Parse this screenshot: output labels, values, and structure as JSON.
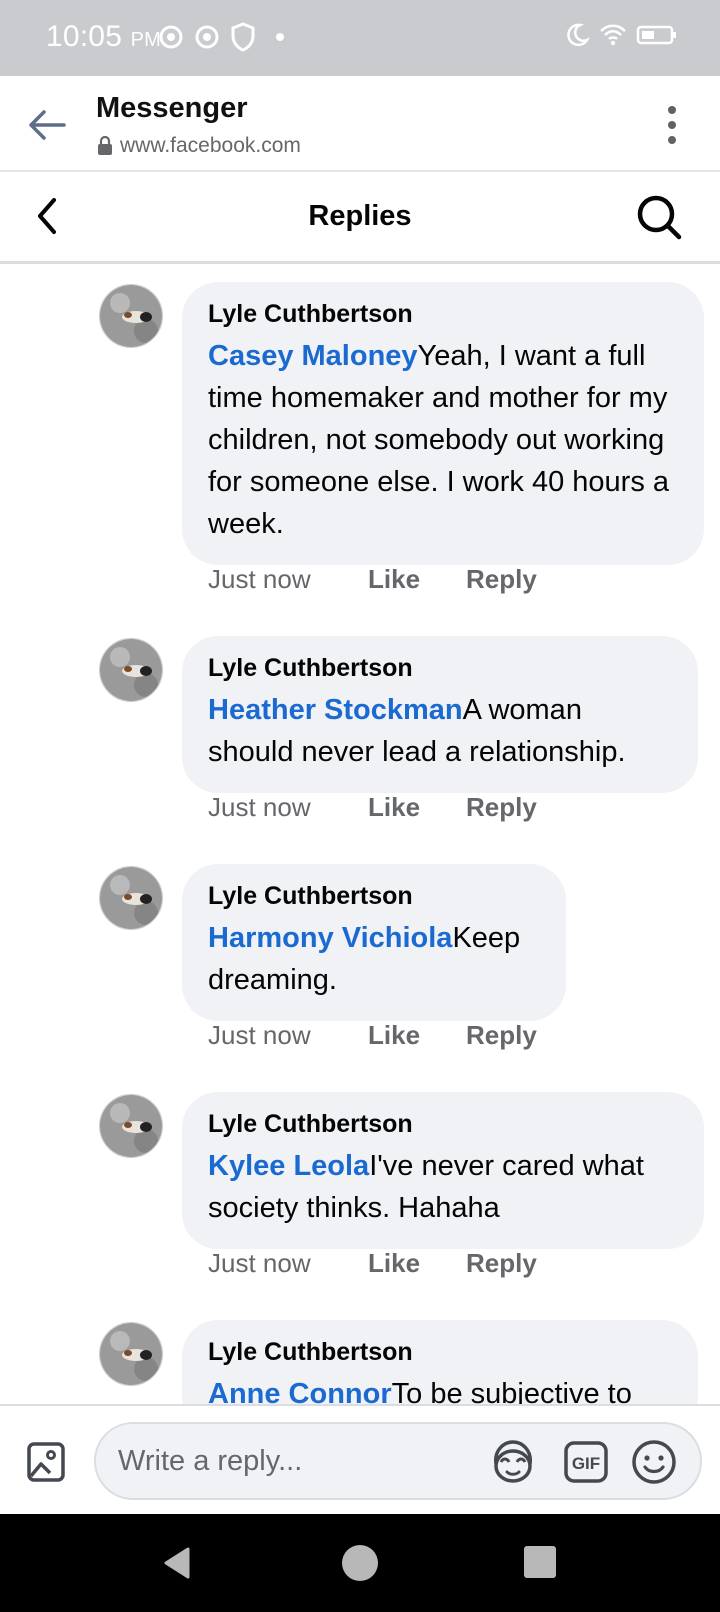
{
  "status_bar": {
    "time": "10:05",
    "ampm": "PM",
    "icons_left": [
      "chrome-icon",
      "chrome-icon",
      "shield-icon",
      "dot-icon"
    ],
    "icons_right": [
      "moon-icon",
      "wifi-icon",
      "battery-icon"
    ]
  },
  "browser": {
    "title": "Messenger",
    "url": "www.facebook.com",
    "icons": [
      "back-arrow-icon",
      "lock-icon",
      "more-vert-icon"
    ]
  },
  "replies_header": {
    "title": "Replies",
    "icons": [
      "chevron-left-icon",
      "search-icon"
    ]
  },
  "comments": [
    {
      "author": "Lyle Cuthbertson",
      "mention": "Casey Maloney",
      "text": "Yeah, I want a full time homemaker and mother for my children, not somebody out working for someone else. I work 40 hours a week.",
      "time": "Just now",
      "like": "Like",
      "reply": "Reply"
    },
    {
      "author": "Lyle Cuthbertson",
      "mention": "Heather Stockman",
      "text": "A woman should never lead a relationship.",
      "time": "Just now",
      "like": "Like",
      "reply": "Reply"
    },
    {
      "author": "Lyle Cuthbertson",
      "mention": "Harmony Vichiola",
      "text": "Keep dreaming.",
      "time": "Just now",
      "like": "Like",
      "reply": "Reply"
    },
    {
      "author": "Lyle Cuthbertson",
      "mention": "Kylee Leola",
      "text": "I've never cared what society thinks. Hahaha",
      "time": "Just now",
      "like": "Like",
      "reply": "Reply"
    },
    {
      "author": "Lyle Cuthbertson",
      "mention": "Anne Connor",
      "text": "To be subjective to",
      "time": "",
      "like": "",
      "reply": ""
    }
  ],
  "composer": {
    "placeholder": "Write a reply...",
    "gif_label": "GIF",
    "icons": [
      "photo-icon",
      "avatar-sticker-icon",
      "gif-icon",
      "emoji-icon"
    ]
  },
  "nav": {
    "icons": [
      "nav-back-icon",
      "nav-home-icon",
      "nav-recents-icon"
    ]
  },
  "colors": {
    "mention": "#1b6ad1",
    "bubble": "#f0f2f5",
    "status_bar": "#c9cbcf",
    "secondary_text": "#65676b"
  }
}
